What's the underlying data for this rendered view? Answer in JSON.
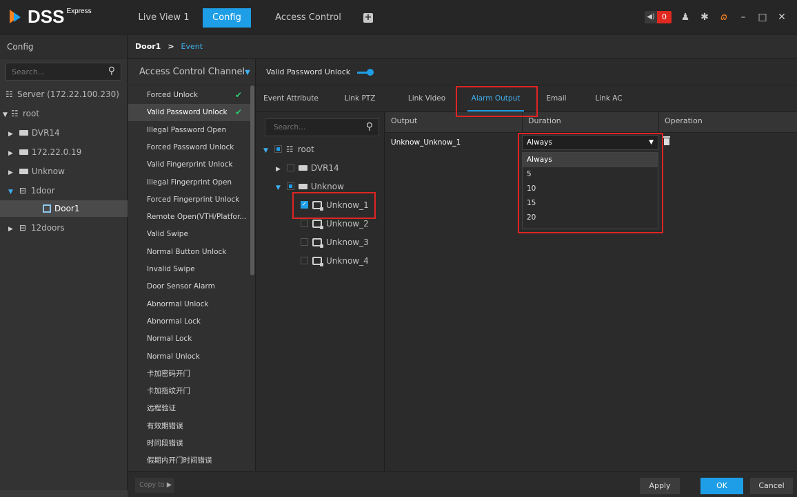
{
  "app": {
    "brand": "DSS",
    "edition": "Express"
  },
  "topbar": {
    "tabs": [
      {
        "label": "Live View 1"
      },
      {
        "label": "Config"
      },
      {
        "label": "Access Control"
      }
    ],
    "add_tab_icon": "plus-icon",
    "alarm_count": "0",
    "accent_color": "#1e9ee6",
    "alarm_color": "#e0281f"
  },
  "left_panel": {
    "title": "Config",
    "search_placeholder": "Search...",
    "tree": [
      {
        "label": "Server (172.22.100.230)"
      },
      {
        "label": "root"
      },
      {
        "label": "DVR14"
      },
      {
        "label": "172.22.0.19"
      },
      {
        "label": "Unknow"
      },
      {
        "label": "1door"
      },
      {
        "label": "Door1"
      },
      {
        "label": "12doors"
      }
    ]
  },
  "breadcrumb": {
    "door": "Door1",
    "separator": ">",
    "current": "Event"
  },
  "channel_panel": {
    "title": "Access Control Channel",
    "events": [
      "Forced Unlock",
      "Valid Password Unlock",
      "Illegal Password Open",
      "Forced Password Unlock",
      "Valid Fingerprint Unlock",
      "Illegal Fingerprint Open",
      "Forced Fingerprint Unlock",
      "Remote Open(VTH/Platfor...",
      "Valid Swipe",
      "Normal Button Unlock",
      "Invalid Swipe",
      "Door Sensor Alarm",
      "Abnormal Unlock",
      "Abnormal Lock",
      "Normal Lock",
      "Normal Unlock",
      "卡加密码开门",
      "卡加指纹开门",
      "远程验证",
      "有效期错误",
      "时间段错误",
      "假期内开门时间错误"
    ]
  },
  "config": {
    "event_title": "Valid Password Unlock",
    "event_enabled": true,
    "tabs": [
      "Event Attribute",
      "Link PTZ",
      "Link Video",
      "Alarm Output",
      "Email",
      "Link AC"
    ],
    "active_tab": "Alarm Output",
    "device_tree": {
      "search_placeholder": "Search...",
      "nodes": [
        "root",
        "DVR14",
        "Unknow",
        "Unknow_1",
        "Unknow_2",
        "Unknow_3",
        "Unknow_4"
      ]
    },
    "table": {
      "columns": [
        "Output",
        "Duration",
        "Operation"
      ],
      "rows": [
        {
          "output": "Unknow_Unknow_1",
          "duration": "Always"
        }
      ],
      "duration_options": [
        "Always",
        "5",
        "10",
        "15",
        "20"
      ]
    }
  },
  "footer": {
    "copy_to": "Copy to",
    "apply": "Apply",
    "ok": "OK",
    "cancel": "Cancel"
  }
}
